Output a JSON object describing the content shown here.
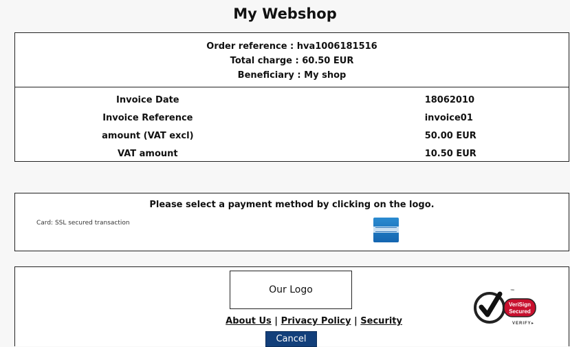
{
  "page": {
    "title": "My Webshop"
  },
  "summary": {
    "order_reference": "Order reference : hva1006181516",
    "total_charge": "Total charge : 60.50 EUR",
    "beneficiary": "Beneficiary : My shop"
  },
  "invoice": {
    "rows": [
      {
        "label": "Invoice Date",
        "value": "18062010"
      },
      {
        "label": "Invoice Reference",
        "value": "invoice01"
      },
      {
        "label": "amount (VAT excl)",
        "value": "50.00 EUR"
      },
      {
        "label": "VAT amount",
        "value": "10.50 EUR"
      }
    ]
  },
  "payment": {
    "prompt": "Please select a payment method by clicking on the logo.",
    "note": "Card: SSL secured transaction",
    "card_icon": "amex-card-icon"
  },
  "footer": {
    "logo_text": "Our Logo",
    "links": {
      "about": "About Us",
      "privacy": "Privacy Policy",
      "security": "Security",
      "separator": "|"
    },
    "cancel_label": "Cancel",
    "verisign": {
      "line1": "VeriSign",
      "line2": "Secured",
      "line3": "VERIFY",
      "trademark": "™",
      "arrow": "▸"
    }
  },
  "colors": {
    "cancel_bg": "#123f7a",
    "amex_blue": "#1f78c4",
    "verisign_red": "#c8102e"
  }
}
